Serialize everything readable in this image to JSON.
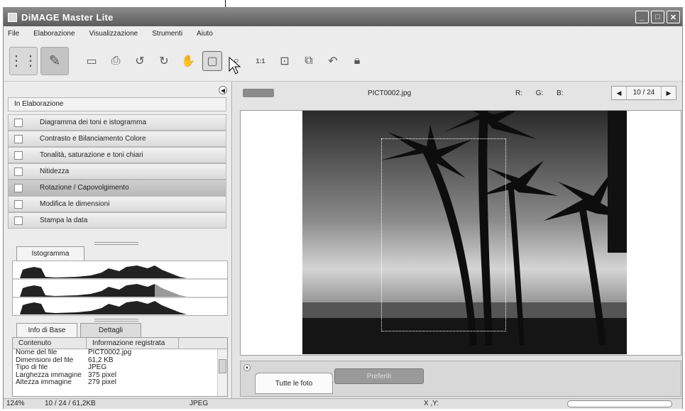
{
  "window": {
    "title": "DiMAGE Master Lite"
  },
  "menu": [
    "File",
    "Elaborazione",
    "Visualizzazione",
    "Strumenti",
    "Aiuto"
  ],
  "processing": {
    "header": "In Elaborazione",
    "items": [
      "Diagramma dei toni e istogramma",
      "Contrasto e Bilanciamento Colore",
      "Tonalità, saturazione e toni chiari",
      "Nitidezza",
      "Rotazione / Capovolgimento",
      "Modifica le dimensioni",
      "Stampa la data"
    ]
  },
  "histogram": {
    "tab": "Istogramma"
  },
  "info": {
    "tabs": [
      "Info di Base",
      "Dettagli"
    ],
    "columns": [
      "Contenuto",
      "Informazione registrata"
    ],
    "rows": [
      {
        "k": "Nome del file",
        "v": "PICT0002.jpg"
      },
      {
        "k": "Dimensioni del file",
        "v": "61,2 KB"
      },
      {
        "k": "Tipo di file",
        "v": "JPEG"
      },
      {
        "k": "Larghezza immagine",
        "v": "375 pixel"
      },
      {
        "k": "Altezza immagine",
        "v": "279 pixel"
      }
    ]
  },
  "viewer": {
    "filename": "PICT0002.jpg",
    "rgb": "R: G: B:",
    "counter": "10 / 24"
  },
  "bottom": {
    "tab_all": "Tutte le foto",
    "tab_fav": "Preferiti"
  },
  "status": {
    "zoom": "124%",
    "position": "10 / 24 / 61,2KB",
    "type": "JPEG",
    "coords": "X ,Y:"
  }
}
